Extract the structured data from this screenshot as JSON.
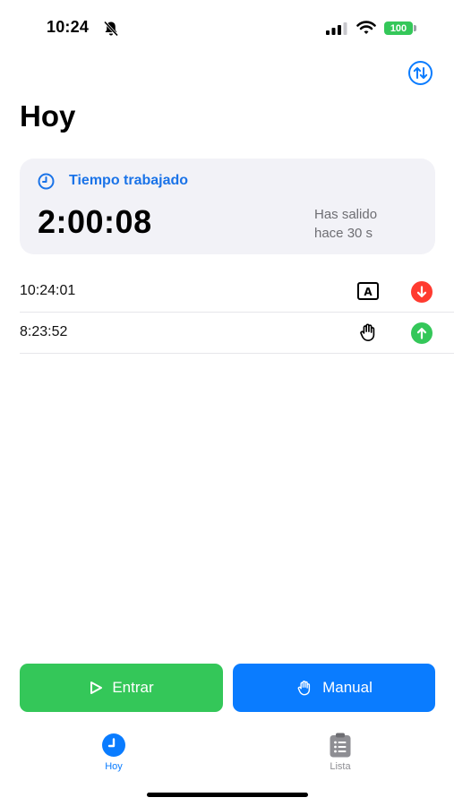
{
  "status_bar": {
    "time": "10:24",
    "battery": "100",
    "icons": [
      "bell-slash-icon",
      "cellular-signal-icon",
      "wifi-icon",
      "battery-icon"
    ]
  },
  "header": {
    "title": "Hoy",
    "sort_icon": "arrow-up-down-circle-icon"
  },
  "worked_card": {
    "label": "Tiempo trabajado",
    "elapsed": "2:00:08",
    "status_line1": "Has salido",
    "status_line2": "hace 30 s",
    "accent_color": "#1a73e8"
  },
  "entries": [
    {
      "time": "10:24:01",
      "source_icon": "automatic-icon",
      "source_label": "A",
      "direction": "out",
      "direction_icon": "arrow-down-circle-icon",
      "color": "#ff3b30"
    },
    {
      "time": "8:23:52",
      "source_icon": "hand-icon",
      "direction": "in",
      "direction_icon": "arrow-up-circle-icon",
      "color": "#34c759"
    }
  ],
  "actions": {
    "enter_label": "Entrar",
    "enter_color": "#34c759",
    "manual_label": "Manual",
    "manual_color": "#0a7cff"
  },
  "tabbar": {
    "items": [
      {
        "label": "Hoy",
        "icon": "clock-icon",
        "active": true,
        "color": "#0a7cff"
      },
      {
        "label": "Lista",
        "icon": "clipboard-list-icon",
        "active": false,
        "color": "#8e8e93"
      }
    ]
  }
}
